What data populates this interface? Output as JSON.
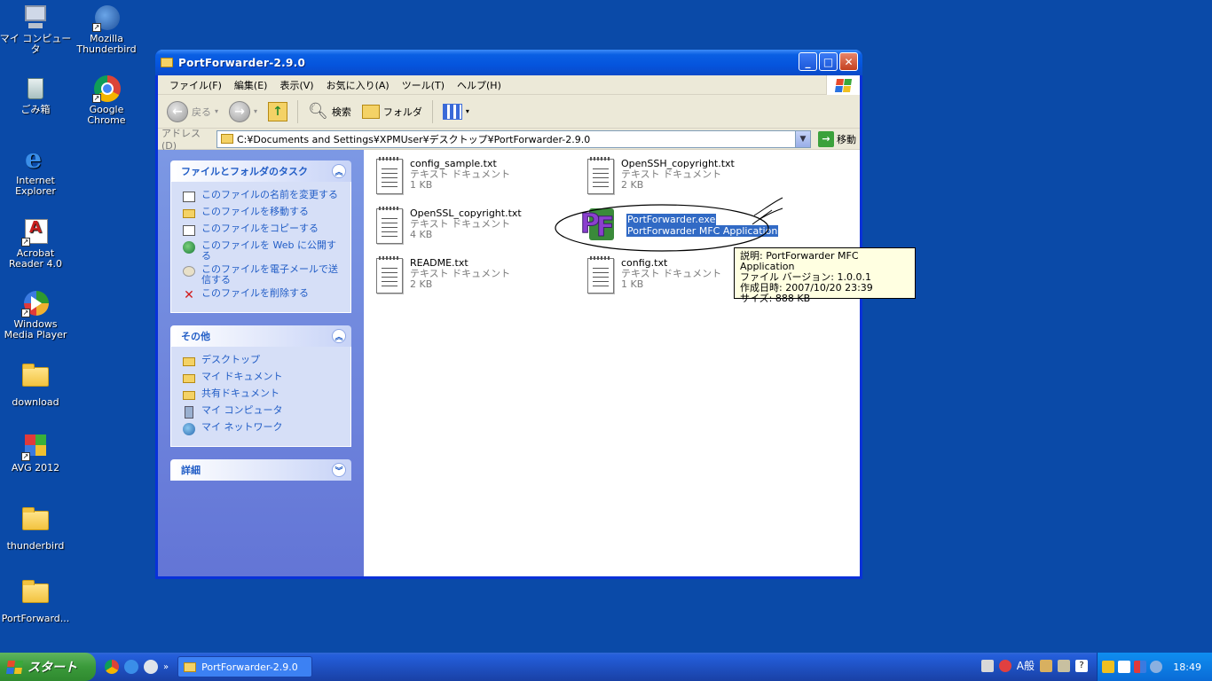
{
  "desktop": {
    "icons": [
      {
        "label": "マイ コンピュータ"
      },
      {
        "label": "Mozilla Thunderbird"
      },
      {
        "label": "ごみ箱"
      },
      {
        "label": "Google Chrome"
      },
      {
        "label": "Internet Explorer"
      },
      {
        "label": "Acrobat Reader 4.0"
      },
      {
        "label": "Windows Media Player"
      },
      {
        "label": "download"
      },
      {
        "label": "AVG 2012"
      },
      {
        "label": "thunderbird"
      },
      {
        "label": "PortForward..."
      }
    ]
  },
  "window": {
    "title": "PortForwarder-2.9.0",
    "menu": [
      "ファイル(F)",
      "編集(E)",
      "表示(V)",
      "お気に入り(A)",
      "ツール(T)",
      "ヘルプ(H)"
    ],
    "toolbar": {
      "back": "戻る",
      "search": "検索",
      "folders": "フォルダ"
    },
    "address": {
      "label": "アドレス(D)",
      "path": "C:¥Documents and Settings¥XPMUser¥デスクトップ¥PortForwarder-2.9.0",
      "go": "移動"
    },
    "taskpane": {
      "file_tasks": {
        "title": "ファイルとフォルダのタスク",
        "items": [
          "このファイルの名前を変更する",
          "このファイルを移動する",
          "このファイルをコピーする",
          "このファイルを Web に公開する",
          "このファイルを電子メールで送信する",
          "このファイルを削除する"
        ]
      },
      "other": {
        "title": "その他",
        "items": [
          "デスクトップ",
          "マイ ドキュメント",
          "共有ドキュメント",
          "マイ コンピュータ",
          "マイ ネットワーク"
        ]
      },
      "details": {
        "title": "詳細"
      }
    },
    "files": [
      {
        "name": "config_sample.txt",
        "type": "テキスト ドキュメント",
        "size": "1 KB"
      },
      {
        "name": "OpenSSH_copyright.txt",
        "type": "テキスト ドキュメント",
        "size": "2 KB"
      },
      {
        "name": "OpenSSL_copyright.txt",
        "type": "テキスト ドキュメント",
        "size": "4 KB"
      },
      {
        "name": "PortForwarder.exe",
        "type": "PortForwarder MFC Application",
        "size": ""
      },
      {
        "name": "README.txt",
        "type": "テキスト ドキュメント",
        "size": "2 KB"
      },
      {
        "name": "config.txt",
        "type": "テキスト ドキュメント",
        "size": "1 KB"
      }
    ],
    "tooltip": {
      "line1": "説明: PortForwarder MFC Application",
      "line2": "ファイル バージョン: 1.0.0.1",
      "line3": "作成日時: 2007/10/20 23:39",
      "line4": "サイズ: 888 KB"
    }
  },
  "taskbar": {
    "start": "スタート",
    "active_task": "PortForwarder-2.9.0",
    "ime": "A般",
    "clock": "18:49"
  }
}
